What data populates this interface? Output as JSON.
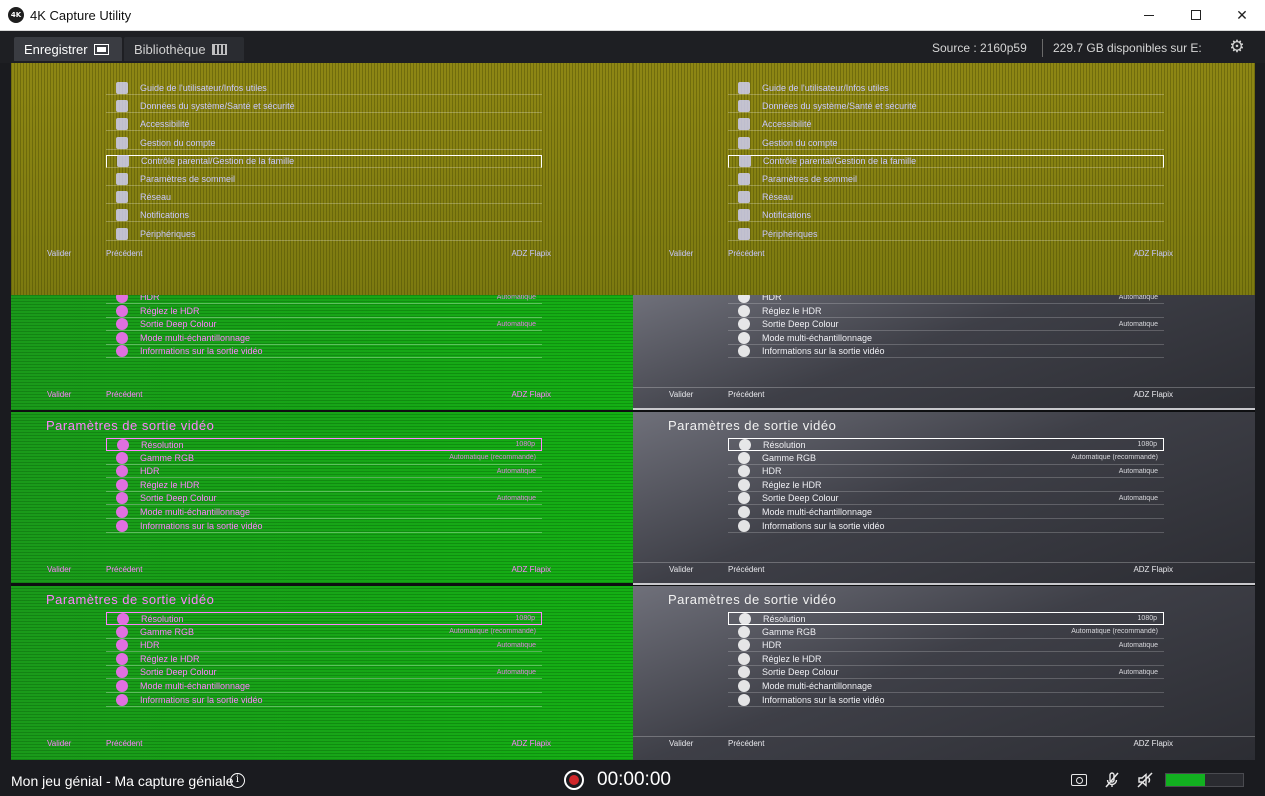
{
  "window": {
    "title": "4K Capture Utility",
    "icon_text": "4K",
    "min_label": "",
    "max_label": "",
    "close_label": "✕"
  },
  "toolbar": {
    "tab_record": "Enregistrer",
    "tab_library": "Bibliothèque",
    "source": "Source : 2160p59",
    "space": "229.7 GB disponibles sur E:"
  },
  "preview": {
    "top_menu": {
      "items": [
        "Guide de l'utilisateur/Infos utiles",
        "Données du système/Santé et sécurité",
        "Accessibilité",
        "Gestion du compte",
        "Contrôle parental/Gestion de la famille",
        "Paramètres de sommeil",
        "Réseau",
        "Notifications",
        "Périphériques"
      ],
      "selected_index": 4,
      "footer_ok": "Valider",
      "footer_back": "Précédent",
      "footer_user": "ADZ Flapix"
    },
    "mid_menu": {
      "items": [
        {
          "label": "HDR",
          "value": "Automatique"
        },
        {
          "label": "Réglez le HDR",
          "value": ""
        },
        {
          "label": "Sortie Deep Colour",
          "value": "Automatique"
        },
        {
          "label": "Mode multi-échantillonnage",
          "value": ""
        },
        {
          "label": "Informations sur la sortie vidéo",
          "value": ""
        }
      ],
      "footer_ok": "Valider",
      "footer_back": "Précédent",
      "footer_user": "ADZ Flapix"
    },
    "video_menu": {
      "title": "Paramètres de sortie vidéo",
      "items": [
        {
          "label": "Résolution",
          "value": "1080p"
        },
        {
          "label": "Gamme RGB",
          "value": "Automatique (recommandé)"
        },
        {
          "label": "HDR",
          "value": "Automatique"
        },
        {
          "label": "Réglez le HDR",
          "value": ""
        },
        {
          "label": "Sortie Deep Colour",
          "value": "Automatique"
        },
        {
          "label": "Mode multi-échantillonnage",
          "value": ""
        },
        {
          "label": "Informations sur la sortie vidéo",
          "value": ""
        }
      ],
      "selected_index": 0,
      "footer_ok": "Valider",
      "footer_back": "Précédent",
      "footer_user": "ADZ Flapix"
    }
  },
  "status": {
    "capture_name": "Mon jeu génial - Ma capture géniale",
    "info_icon": "i",
    "timer": "00:00:00",
    "meter_level": 0.5
  },
  "colors": {
    "record": "#d0262a",
    "meter": "#12b020",
    "green_band": "#12a012",
    "yellow_band": "#8a8410",
    "magenta_text": "#ff80ff"
  },
  "icons": {
    "gear": "gear-icon",
    "camera": "camera-icon",
    "mic_muted": "mic-muted-icon",
    "speaker_muted": "speaker-muted-icon"
  }
}
